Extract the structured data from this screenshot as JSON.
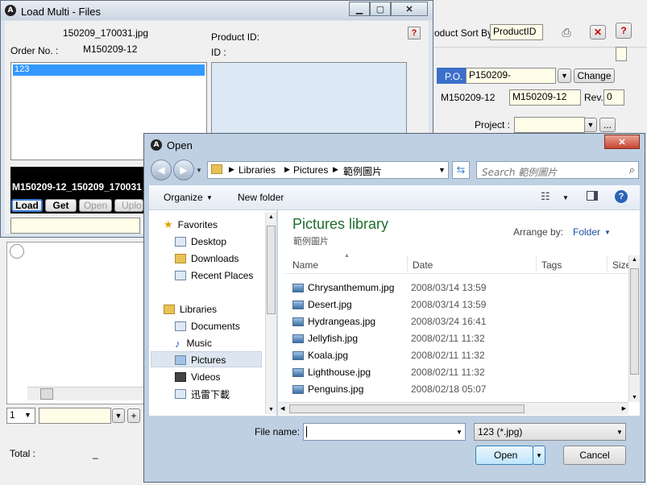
{
  "main_window": {
    "sort_label": "oduct Sort By",
    "sort_value": "ProductID",
    "po_label": "P.O.",
    "po_value": "P150209-",
    "change_button": "Change",
    "order_value_1": "M150209-12",
    "order_value_2": "M150209-12",
    "rev_label": "Rev.",
    "rev_value": "0",
    "project_label": "Project :",
    "project_button": "...",
    "page_value": "1",
    "plus_button": "+",
    "total_label": "Total :",
    "total_value": "_"
  },
  "load_multi": {
    "title": "Load Multi - Files",
    "filename": "150209_170031.jpg",
    "order_label": "Order No. :",
    "order_value": "M150209-12",
    "product_id_label": "Product ID:",
    "id_label": "ID :",
    "help_button": "?",
    "list_items": [
      "123"
    ],
    "path_text": "M150209-12_150209_170031",
    "buttons": [
      "Load",
      "Get",
      "Open",
      "Uplo"
    ]
  },
  "open_dialog": {
    "title": "Open",
    "breadcrumb": [
      "Libraries",
      "Pictures",
      "範例圖片"
    ],
    "search_placeholder": "Search 範例圖片",
    "organize": "Organize",
    "new_folder": "New folder",
    "library_title": "Pictures library",
    "library_subtitle": "範例圖片",
    "arrange_by_label": "Arrange by:",
    "arrange_by_value": "Folder",
    "columns": [
      "Name",
      "Date",
      "Tags",
      "Size"
    ],
    "nav": {
      "favorites_header": "Favorites",
      "favorites": [
        "Desktop",
        "Downloads",
        "Recent Places"
      ],
      "libraries_header": "Libraries",
      "libraries": [
        "Documents",
        "Music",
        "Pictures",
        "Videos",
        "迅雷下載"
      ]
    },
    "files": [
      {
        "name": "Chrysanthemum.jpg",
        "date": "2008/03/14 13:59"
      },
      {
        "name": "Desert.jpg",
        "date": "2008/03/14 13:59"
      },
      {
        "name": "Hydrangeas.jpg",
        "date": "2008/03/24 16:41"
      },
      {
        "name": "Jellyfish.jpg",
        "date": "2008/02/11 11:32"
      },
      {
        "name": "Koala.jpg",
        "date": "2008/02/11 11:32"
      },
      {
        "name": "Lighthouse.jpg",
        "date": "2008/02/11 11:32"
      },
      {
        "name": "Penguins.jpg",
        "date": "2008/02/18 05:07"
      }
    ],
    "filename_label": "File name:",
    "filename_value": "",
    "filetype_value": "123 (*.jpg)",
    "open_button": "Open",
    "cancel_button": "Cancel"
  }
}
